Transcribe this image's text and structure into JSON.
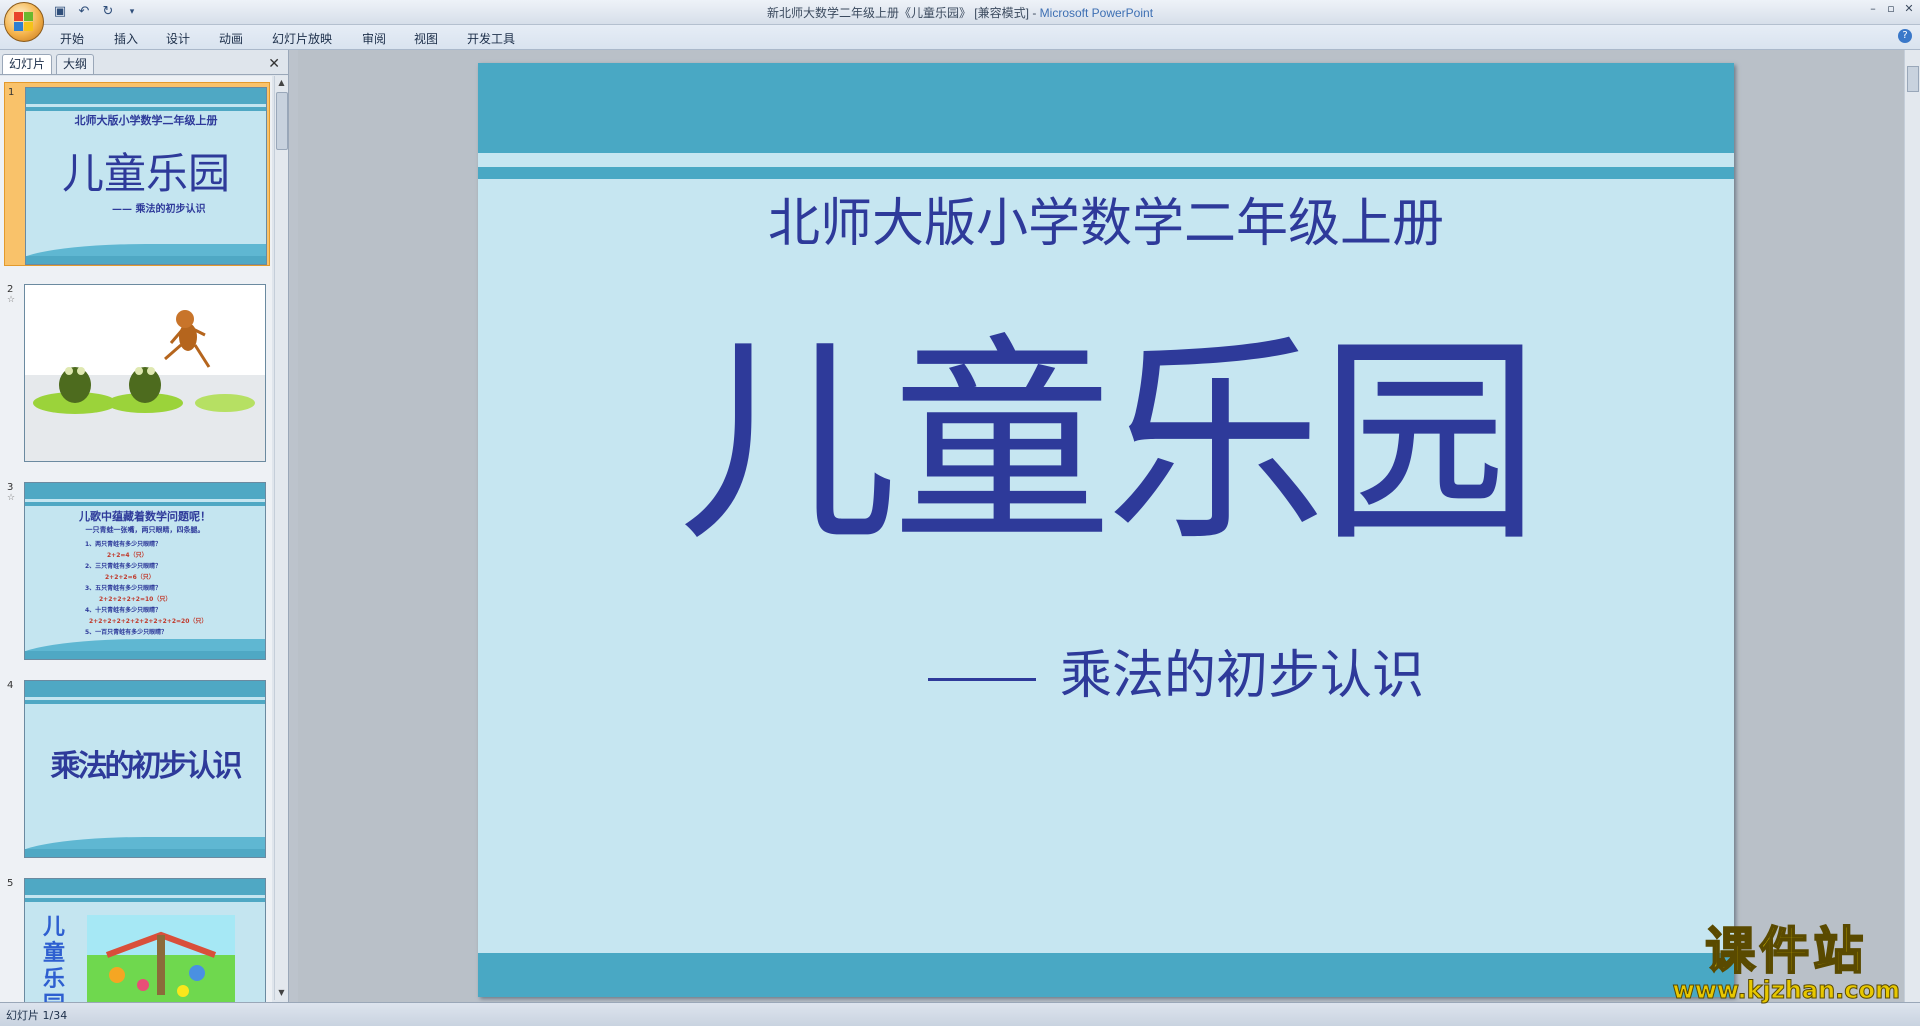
{
  "window": {
    "title": "新北师大数学二年级上册《儿童乐园》 [兼容模式]",
    "app_name": "Microsoft PowerPoint"
  },
  "ribbon": {
    "tabs": [
      "开始",
      "插入",
      "设计",
      "动画",
      "幻灯片放映",
      "审阅",
      "视图",
      "开发工具"
    ]
  },
  "panel": {
    "tabs": [
      "幻灯片",
      "大纲"
    ]
  },
  "thumbnails": [
    {
      "num": "1",
      "top": "北师大版小学数学二年级上册",
      "title": "儿童乐园",
      "sub": "—— 乘法的初步认识"
    },
    {
      "num": "2"
    },
    {
      "num": "3",
      "heading": "儿歌中蕴藏着数学问题呢！",
      "intro": "一只青蛙一张嘴，两只眼睛，四条腿。",
      "lines": [
        "1、两只青蛙有多少只眼睛？",
        "2+2=4（只）",
        "2、三只青蛙有多少只眼睛？",
        "2+2+2=6（只）",
        "3、五只青蛙有多少只眼睛？",
        "2+2+2+2+2=10（只）",
        "4、十只青蛙有多少只眼睛？",
        "2+2+2+2+2+2+2+2+2+2=20（只）",
        "5、一百只青蛙有多少只眼睛？"
      ]
    },
    {
      "num": "4",
      "title": "乘法的初步认识"
    },
    {
      "num": "5",
      "vtitle": "儿童乐园"
    }
  ],
  "slide": {
    "top_text": "北师大版小学数学二年级上册",
    "title": "儿童乐园",
    "subtitle": "乘法的初步认识"
  },
  "status": {
    "slide_counter": "幻灯片 1/34"
  },
  "watermark": {
    "line1": "课件站",
    "line2": "www.kjzhan.com"
  },
  "colors": {
    "slide_bg": "#c6e6f1",
    "band": "#49a8c4",
    "text_blue": "#2e3a9a",
    "selection": "#f9c26a"
  }
}
